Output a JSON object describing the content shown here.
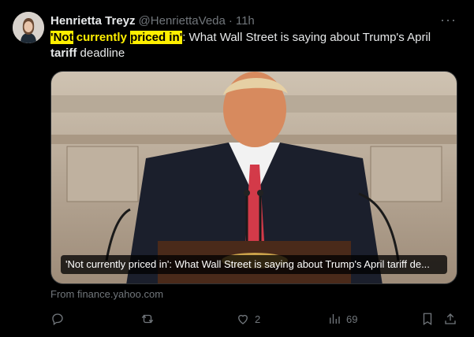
{
  "tweet": {
    "author_name": "Henrietta Treyz",
    "handle": "@HenriettaVeda",
    "separator": "·",
    "time": "11h",
    "more_label": "···",
    "text_parts": {
      "quote_open": "'",
      "not": "Not",
      "currently": " currently ",
      "priced_in": "priced in",
      "quote_close": "'",
      "middle": ": What Wall Street is saying about Trump's April ",
      "tariff": "tariff",
      "end": " deadline"
    },
    "link_card": {
      "caption": "'Not currently priced in': What Wall Street is saying about Trump's April tariff de...",
      "source": "From finance.yahoo.com"
    },
    "actions": {
      "reply_count": "",
      "retweet_count": "",
      "like_count": "2",
      "views_count": "69"
    }
  },
  "icons": [
    "avatar",
    "more-icon",
    "reply-icon",
    "retweet-icon",
    "like-icon",
    "views-icon",
    "bookmark-icon",
    "share-icon"
  ],
  "colors": {
    "background": "#000000",
    "text": "#e7e9ea",
    "muted": "#71767b",
    "highlight": "#ffef00"
  }
}
